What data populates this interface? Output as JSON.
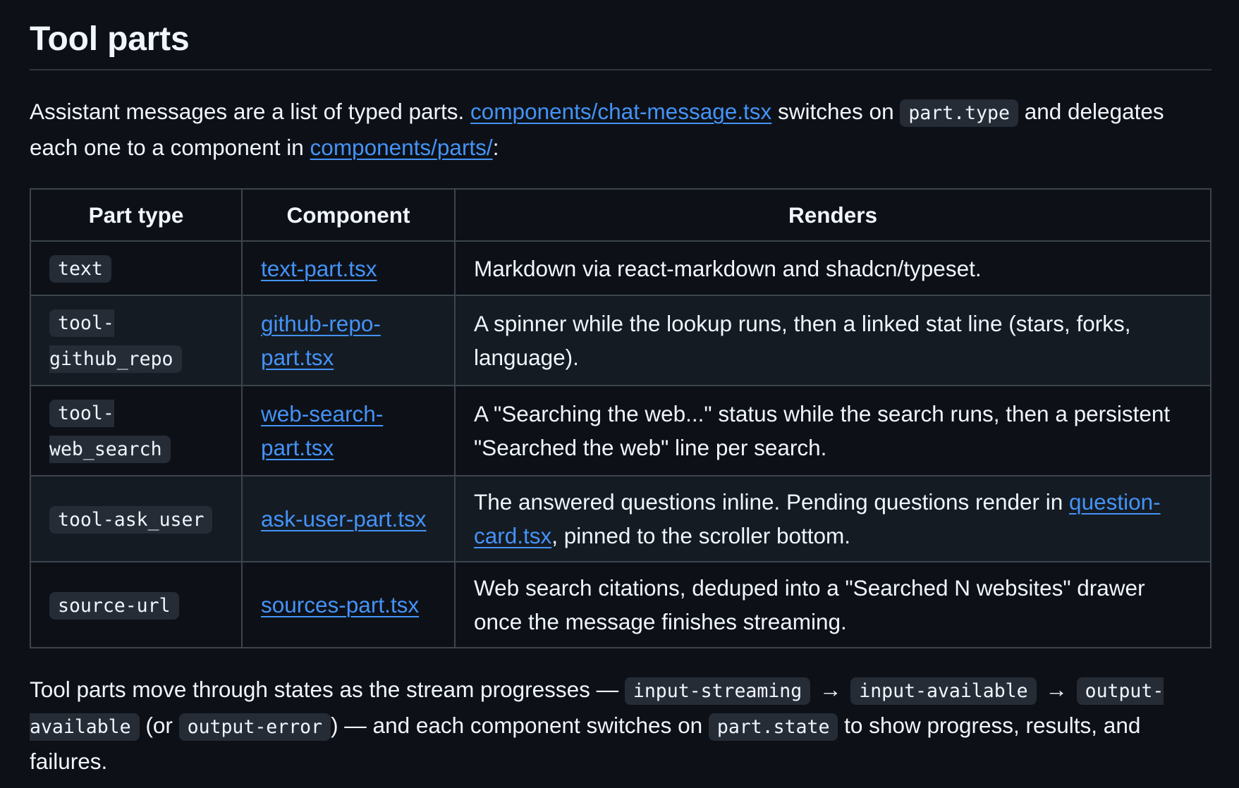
{
  "heading": "Tool parts",
  "intro": {
    "t1": "Assistant messages are a list of typed parts. ",
    "link1": "components/chat-message.tsx",
    "t2": " switches on ",
    "code1": "part.type",
    "t3": " and delegates each one to a component in ",
    "link2": "components/parts/",
    "t4": ":"
  },
  "table": {
    "headers": [
      "Part type",
      "Component",
      "Renders"
    ],
    "rows": [
      {
        "part_type": "text",
        "component": "text-part.tsx",
        "renders": "Markdown via react-markdown and shadcn/typeset."
      },
      {
        "part_type": "tool-github_repo",
        "component": "github-repo-part.tsx",
        "renders": "A spinner while the lookup runs, then a linked stat line (stars, forks, language)."
      },
      {
        "part_type": "tool-web_search",
        "component": "web-search-part.tsx",
        "renders": "A \"Searching the web...\" status while the search runs, then a persistent \"Searched the web\" line per search."
      },
      {
        "part_type": "tool-ask_user",
        "component": "ask-user-part.tsx",
        "renders_pre": "The answered questions inline. Pending questions render in ",
        "renders_link": "question-card.tsx",
        "renders_post": ", pinned to the scroller bottom."
      },
      {
        "part_type": "source-url",
        "component": "sources-part.tsx",
        "renders": "Web search citations, deduped into a \"Searched N websites\" drawer once the message finishes streaming."
      }
    ]
  },
  "outro": {
    "t1": "Tool parts move through states as the stream progresses — ",
    "code1": "input-streaming",
    "arrow1": "→",
    "code2": "input-available",
    "arrow2": "→",
    "code3": "output-available",
    "t2": " (or ",
    "code4": "output-error",
    "t3": ") — and each component switches on ",
    "code5": "part.state",
    "t4": " to show progress, results, and failures."
  }
}
